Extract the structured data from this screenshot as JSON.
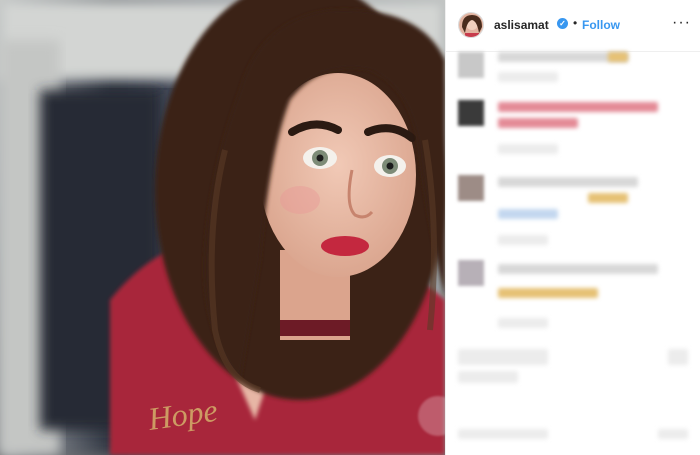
{
  "header": {
    "username": "aslisamat",
    "verified_badge": "verified-check-icon",
    "separator": "•",
    "follow_label": "Follow",
    "more_label": "···"
  },
  "colors": {
    "accent": "#3897f0",
    "shirt": "#a8283a",
    "hair": "#3b2418"
  }
}
